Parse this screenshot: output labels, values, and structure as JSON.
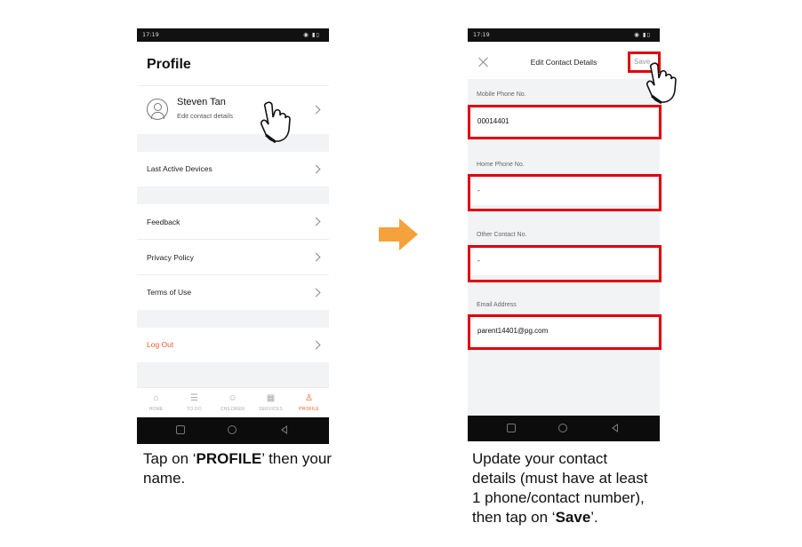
{
  "left_phone": {
    "status_time": "17:19",
    "title": "Profile",
    "user": {
      "name": "Steven Tan",
      "subtitle": "Edit contact details"
    },
    "menu": {
      "last_active_devices": "Last Active Devices",
      "feedback": "Feedback",
      "privacy_policy": "Privacy Policy",
      "terms_of_use": "Terms of Use",
      "log_out": "Log Out"
    },
    "tabs": [
      {
        "label": "HOME",
        "icon": "home-icon"
      },
      {
        "label": "TO DO",
        "icon": "list-icon"
      },
      {
        "label": "CHILDREN",
        "icon": "child-icon"
      },
      {
        "label": "SERVICES",
        "icon": "grid-icon"
      },
      {
        "label": "PROFILE",
        "icon": "person-icon",
        "active": true
      }
    ]
  },
  "right_phone": {
    "status_time": "17:19",
    "header": {
      "title": "Edit Contact Details",
      "save": "Save"
    },
    "fields": {
      "mobile": {
        "label": "Mobile Phone No.",
        "value": "00014401"
      },
      "home": {
        "label": "Home Phone No.",
        "value": "-"
      },
      "other": {
        "label": "Other Contact No.",
        "value": "-"
      },
      "email": {
        "label": "Email Address",
        "value": "parent14401@pg.com"
      }
    }
  },
  "captions": {
    "left": {
      "pre": "Tap on ‘",
      "bold": "PROFILE",
      "post": "’ then your name."
    },
    "right": {
      "pre": "Update your contact details (must have at least 1 phone/contact number), then tap on ‘",
      "bold": "Save",
      "post": "’."
    }
  },
  "colors": {
    "accent": "#ef5a28",
    "highlight": "#e0000e",
    "arrow": "#f5a23c"
  }
}
